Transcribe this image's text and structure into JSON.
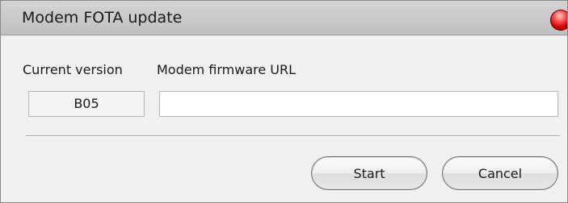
{
  "window": {
    "title": "Modem FOTA update"
  },
  "form": {
    "current_version_label": "Current version",
    "current_version_value": "B05",
    "firmware_url_label": "Modem firmware URL",
    "firmware_url_value": ""
  },
  "buttons": {
    "start_label": "Start",
    "cancel_label": "Cancel"
  },
  "icons": {
    "close": "close-icon"
  },
  "colors": {
    "titlebar": "#c9c9c9",
    "background": "#f0f0f0",
    "close_button": "#d10000"
  }
}
